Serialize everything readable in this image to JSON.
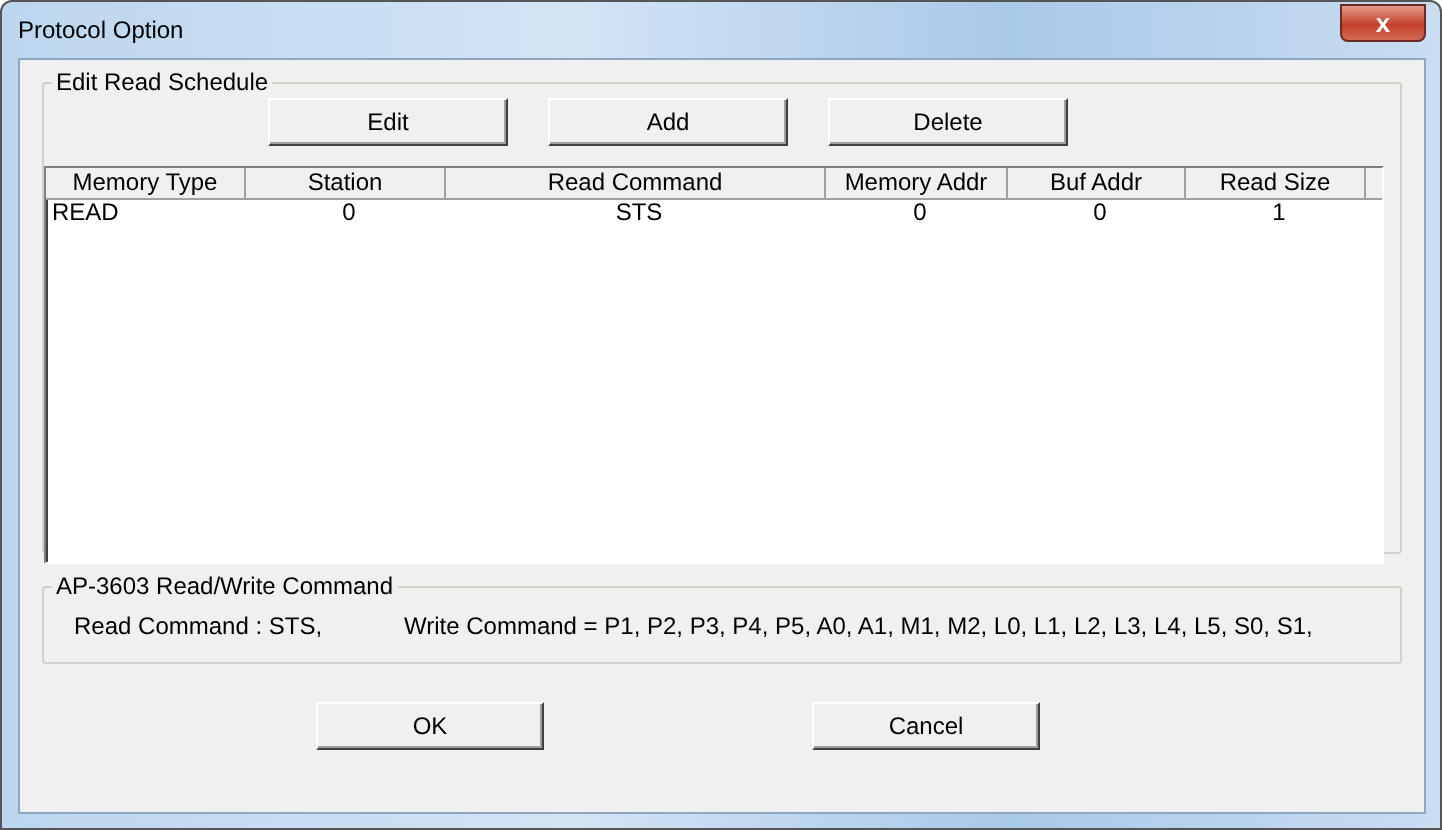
{
  "window": {
    "title": "Protocol Option",
    "close": "x"
  },
  "schedule": {
    "title": "Edit Read Schedule",
    "buttons": [
      "Edit",
      "Add",
      "Delete"
    ],
    "columns": [
      "Memory Type",
      "Station",
      "Read Command",
      "Memory Addr",
      "Buf Addr",
      "Read Size"
    ],
    "rows": [
      [
        "READ",
        "0",
        "STS",
        "0",
        "0",
        "1"
      ]
    ]
  },
  "commands": {
    "title": "AP-3603 Read/Write Command",
    "read": "Read Command : STS,",
    "write": "Write Command = P1, P2, P3, P4, P5, A0, A1, M1, M2, L0, L1, L2, L3, L4, L5, S0, S1,"
  },
  "buttons": [
    "OK",
    "Cancel"
  ]
}
